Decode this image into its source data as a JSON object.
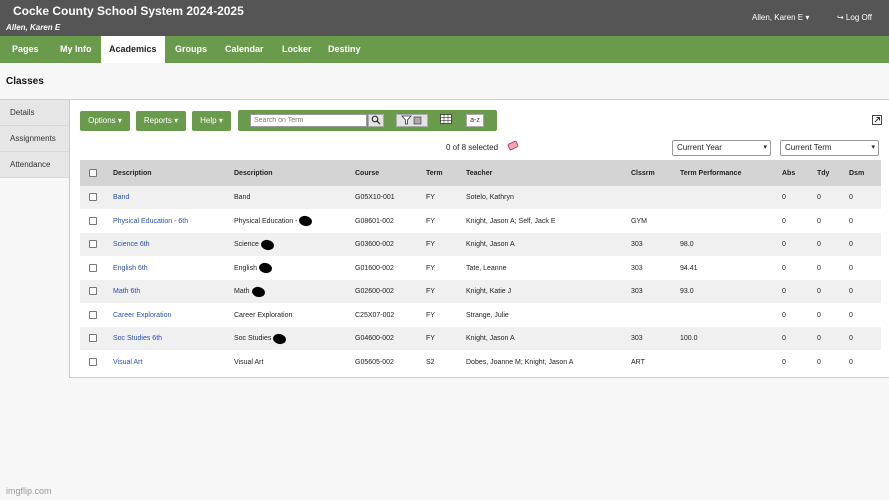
{
  "header": {
    "school_title": "Cocke County School System 2024-2025",
    "user_subtitle": "Allen, Karen E",
    "user_menu": "Allen, Karen E ▾",
    "logoff": "↪ Log Off"
  },
  "nav": {
    "tabs": [
      {
        "label": "Pages"
      },
      {
        "label": "My Info"
      },
      {
        "label": "Academics"
      },
      {
        "label": "Groups"
      },
      {
        "label": "Calendar"
      },
      {
        "label": "Locker"
      },
      {
        "label": "Destiny"
      }
    ],
    "active": "Academics"
  },
  "page": {
    "title": "Classes"
  },
  "sidebar": {
    "items": [
      {
        "label": "Details"
      },
      {
        "label": "Assignments"
      },
      {
        "label": "Attendance"
      }
    ]
  },
  "toolbar": {
    "options_label": "Options ▾",
    "reports_label": "Reports ▾",
    "help_label": "Help ▾",
    "search_placeholder": "Search on Term",
    "search_icon": "search-icon",
    "filter_icon": "filter-icon",
    "grid_icon": "grid-icon",
    "sort_label": "a-z"
  },
  "selection": {
    "count_text": "0 of 8 selected"
  },
  "filters": {
    "year": "Current Year",
    "term": "Current Term"
  },
  "table": {
    "columns": [
      "Description",
      "Description",
      "Course",
      "Term",
      "Teacher",
      "Clssrm",
      "Term Performance",
      "Abs",
      "Tdy",
      "Dsm"
    ],
    "rows": [
      {
        "link": "Band",
        "desc": "Band",
        "course": "G05X10-001",
        "term": "FY",
        "teacher": "Sotelo, Kathryn",
        "room": "",
        "perf": "",
        "abs": "0",
        "tdy": "0",
        "dsm": "0"
      },
      {
        "link": "Physical Education - 6th",
        "desc": "Physical Education -",
        "course": "G08601-002",
        "term": "FY",
        "teacher": "Knight, Jason A; Self, Jack E",
        "room": "GYM",
        "perf": "",
        "abs": "0",
        "tdy": "0",
        "dsm": "0"
      },
      {
        "link": "Science 6th",
        "desc": "Science",
        "course": "G03600-002",
        "term": "FY",
        "teacher": "Knight, Jason A",
        "room": "303",
        "perf": "98.0",
        "abs": "0",
        "tdy": "0",
        "dsm": "0"
      },
      {
        "link": "English 6th",
        "desc": "English",
        "course": "G01600-002",
        "term": "FY",
        "teacher": "Tate, Leanne",
        "room": "303",
        "perf": "94.41",
        "abs": "0",
        "tdy": "0",
        "dsm": "0"
      },
      {
        "link": "Math 6th",
        "desc": "Math",
        "course": "G02600-002",
        "term": "FY",
        "teacher": "Knight, Katie J",
        "room": "303",
        "perf": "93.0",
        "abs": "0",
        "tdy": "0",
        "dsm": "0"
      },
      {
        "link": "Career Exploration",
        "desc": "Career Exploration",
        "course": "C25X07-002",
        "term": "FY",
        "teacher": "Strange, Julie",
        "room": "",
        "perf": "",
        "abs": "0",
        "tdy": "0",
        "dsm": "0"
      },
      {
        "link": "Soc Studies 6th",
        "desc": "Soc Studies",
        "course": "G04600-002",
        "term": "FY",
        "teacher": "Knight, Jason A",
        "room": "303",
        "perf": "100.0",
        "abs": "0",
        "tdy": "0",
        "dsm": "0"
      },
      {
        "link": "Visual Art",
        "desc": "Visual Art",
        "course": "G05605-002",
        "term": "S2",
        "teacher": "Dobes, Joanne M; Knight, Jason A",
        "room": "ART",
        "perf": "",
        "abs": "0",
        "tdy": "0",
        "dsm": "0"
      }
    ]
  },
  "watermark": "imgflip.com",
  "colors": {
    "topbar": "#555555",
    "nav_green": "#6a9a4c",
    "link_blue": "#2850a8",
    "row_alt": "#f0f0f0",
    "header_gray": "#d4d4d4"
  }
}
